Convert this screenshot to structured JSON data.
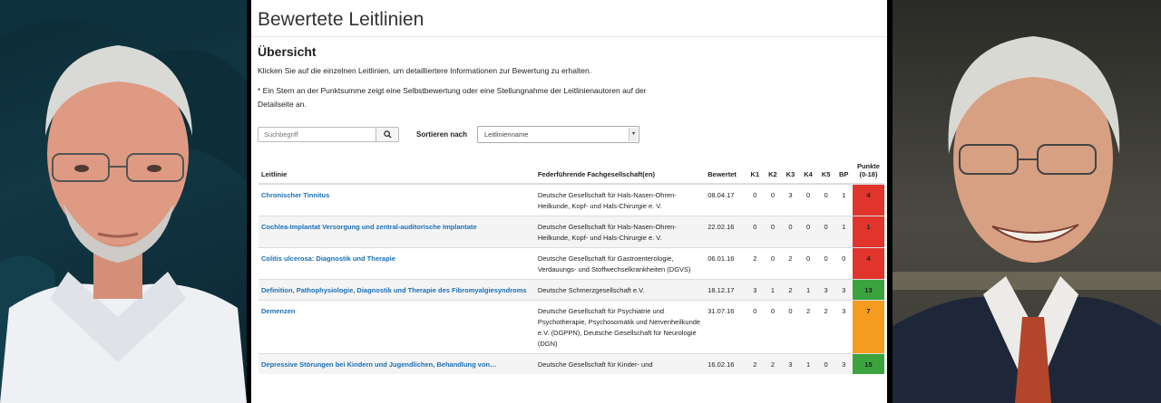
{
  "panel": {
    "title": "Bewertete Leitlinien",
    "section": "Übersicht",
    "intro": "Klicken Sie auf die einzelnen Leitlinien, um detailliertere Informationen zur Bewertung zu erhalten.",
    "note": "* Ein Stern an der Punktsumme zeigt eine Selbstbewertung oder eine Stellungnahme der Leitlinienautoren auf der Detailseite an.",
    "search_placeholder": "Suchbegriff",
    "sort_label": "Sortieren nach",
    "sort_value": "Leitlinienname"
  },
  "table": {
    "headers": {
      "leitlinie": "Leitlinie",
      "fachgesellschaft": "Federführende Fachgesellschaft(en)",
      "bewertet": "Bewertet",
      "k1": "K1",
      "k2": "K2",
      "k3": "K3",
      "k4": "K4",
      "k5": "K5",
      "bp": "BP",
      "punkte": "Punkte (0-18)"
    },
    "rows": [
      {
        "title": "Chronischer Tinnitus",
        "society": "Deutsche Gesellschaft für Hals-Nasen-Ohren-Heilkunde, Kopf- und Hals-Chirurgie e. V.",
        "date": "08.04.17",
        "k1": "0",
        "k2": "0",
        "k3": "3",
        "k4": "0",
        "k5": "0",
        "bp": "1",
        "score": "4",
        "score_color": "#e0342c"
      },
      {
        "title": "Cochlea-Implantat Versorgung und zentral-auditorische Implantate",
        "society": "Deutsche Gesellschaft für Hals-Nasen-Ohren-Heilkunde, Kopf- und Hals-Chirurgie e. V.",
        "date": "22.02.16",
        "k1": "0",
        "k2": "0",
        "k3": "0",
        "k4": "0",
        "k5": "0",
        "bp": "1",
        "score": "1",
        "score_color": "#e0342c"
      },
      {
        "title": "Colitis ulcerosa: Diagnostik und Therapie",
        "society": "Deutsche Gesellschaft für Gastroenterologie, Verdauungs- und Stoffwechselkrankheiten (DGVS)",
        "date": "06.01.16",
        "k1": "2",
        "k2": "0",
        "k3": "2",
        "k4": "0",
        "k5": "0",
        "bp": "0",
        "score": "4",
        "score_color": "#e0342c"
      },
      {
        "title": "Definition, Pathophysiologie, Diagnostik und Therapie des Fibromyalgiesyndroms",
        "society": "Deutsche Schmerzgesellschaft e.V.",
        "date": "18.12.17",
        "k1": "3",
        "k2": "1",
        "k3": "2",
        "k4": "1",
        "k5": "3",
        "bp": "3",
        "score": "13",
        "score_color": "#3aa33d"
      },
      {
        "title": "Demenzen",
        "society": "Deutsche Gesellschaft für Psychiatrie und Psychotherapie, Psychosomatik und Nervenheilkunde e.V. (DGPPN), Deutsche Gesellschaft für Neurologie (DGN)",
        "date": "31.07.16",
        "k1": "0",
        "k2": "0",
        "k3": "0",
        "k4": "2",
        "k5": "2",
        "bp": "3",
        "score": "7",
        "score_color": "#f39c1f"
      },
      {
        "title": "Depressive Störungen bei Kindern und Jugendlichen, Behandlung von…",
        "society": "Deutsche Gesellschaft für Kinder- und",
        "date": "16.02.16",
        "k1": "2",
        "k2": "2",
        "k3": "3",
        "k4": "1",
        "k5": "0",
        "bp": "3",
        "score": "15",
        "score_color": "#3aa33d"
      }
    ]
  }
}
